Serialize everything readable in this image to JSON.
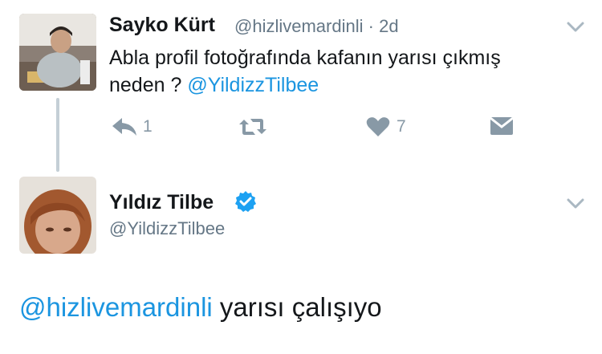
{
  "tweet1": {
    "display_name": "Sayko Kürt",
    "handle": "@hizlivemardinli",
    "separator": "·",
    "time": "2d",
    "text_line1": "Abla profil fotoğrafında kafanın yarısı çıkmış",
    "text_line2_prefix": "neden ?",
    "text_mention": "@YildizzTilbee",
    "reply_count": "1",
    "like_count": "7",
    "icons": [
      "reply-icon",
      "retweet-icon",
      "heart-icon",
      "direct-message-icon",
      "chevron-down-icon"
    ]
  },
  "tweet2": {
    "display_name": "Yıldız Tilbe",
    "handle": "@YildizzTilbee",
    "verified": true,
    "reply_mention": "@hizlivemardinli",
    "reply_text": "yarısı çalışıyo",
    "icons": [
      "verified-badge-icon",
      "chevron-down-icon"
    ]
  },
  "colors": {
    "link": "#1b95e0",
    "secondary_text": "#657786",
    "action_icon": "#8899a6",
    "thread_line": "#c4cfd6",
    "verified": "#1da1f2"
  }
}
